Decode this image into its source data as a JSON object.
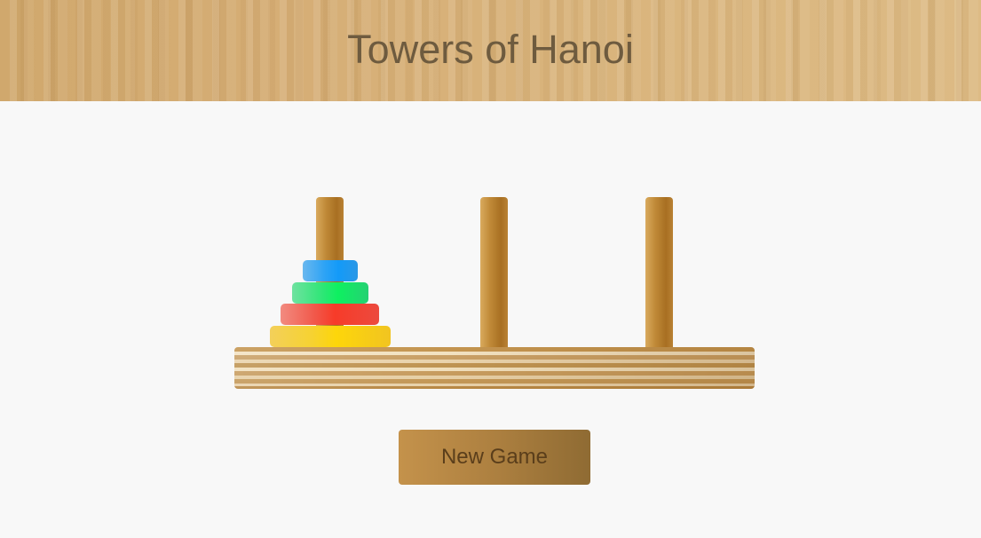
{
  "header": {
    "title": "Towers of Hanoi"
  },
  "game": {
    "pegs": [
      {
        "id": 1,
        "disks": [
          "blue",
          "green",
          "red",
          "yellow"
        ]
      },
      {
        "id": 2,
        "disks": []
      },
      {
        "id": 3,
        "disks": []
      }
    ],
    "disk_colors": {
      "blue": "#139af8",
      "green": "#0ef060",
      "red": "#f73b29",
      "yellow": "#fdd60a"
    }
  },
  "controls": {
    "new_game_label": "New Game"
  },
  "colors": {
    "background": "#f8f8f8",
    "header_wood": "#d6ae76",
    "peg_wood": "#b98234",
    "button": "#ad8040",
    "title_text": "#6e5b3f"
  }
}
